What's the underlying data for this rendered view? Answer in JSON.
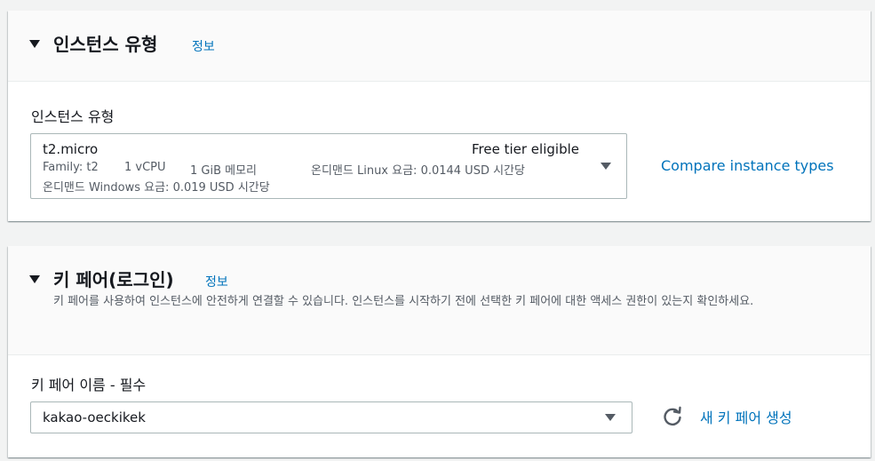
{
  "instance_type_section": {
    "title": "인스턴스 유형",
    "info_link": "정보",
    "field_label": "인스턴스 유형",
    "selected": {
      "name": "t2.micro",
      "tag": "Free tier eligible",
      "family": "Family: t2",
      "vcpu": "1 vCPU",
      "memory": "1 GiB 메모리",
      "linux_price": "온디맨드 Linux 요금: 0.0144 USD 시간당",
      "windows_price": "온디맨드 Windows 요금: 0.019 USD 시간당"
    },
    "compare_link": "Compare instance types"
  },
  "key_pair_section": {
    "title": "키 페어(로그인)",
    "info_link": "정보",
    "description": "키 페어를 사용하여 인스턴스에 안전하게 연결할 수 있습니다. 인스턴스를 시작하기 전에 선택한 키 페어에 대한 액세스 권한이 있는지 확인하세요.",
    "field_label": "키 페어 이름 - 필수",
    "selected_value": "kakao-oeckikek",
    "create_link": "새 키 페어 생성"
  },
  "colors": {
    "link": "#0073bb",
    "text": "#16191f",
    "secondary_text": "#545b64",
    "background": "#f2f3f3"
  },
  "icons": [
    "caret-down-icon",
    "dropdown-caret-icon",
    "refresh-icon"
  ]
}
